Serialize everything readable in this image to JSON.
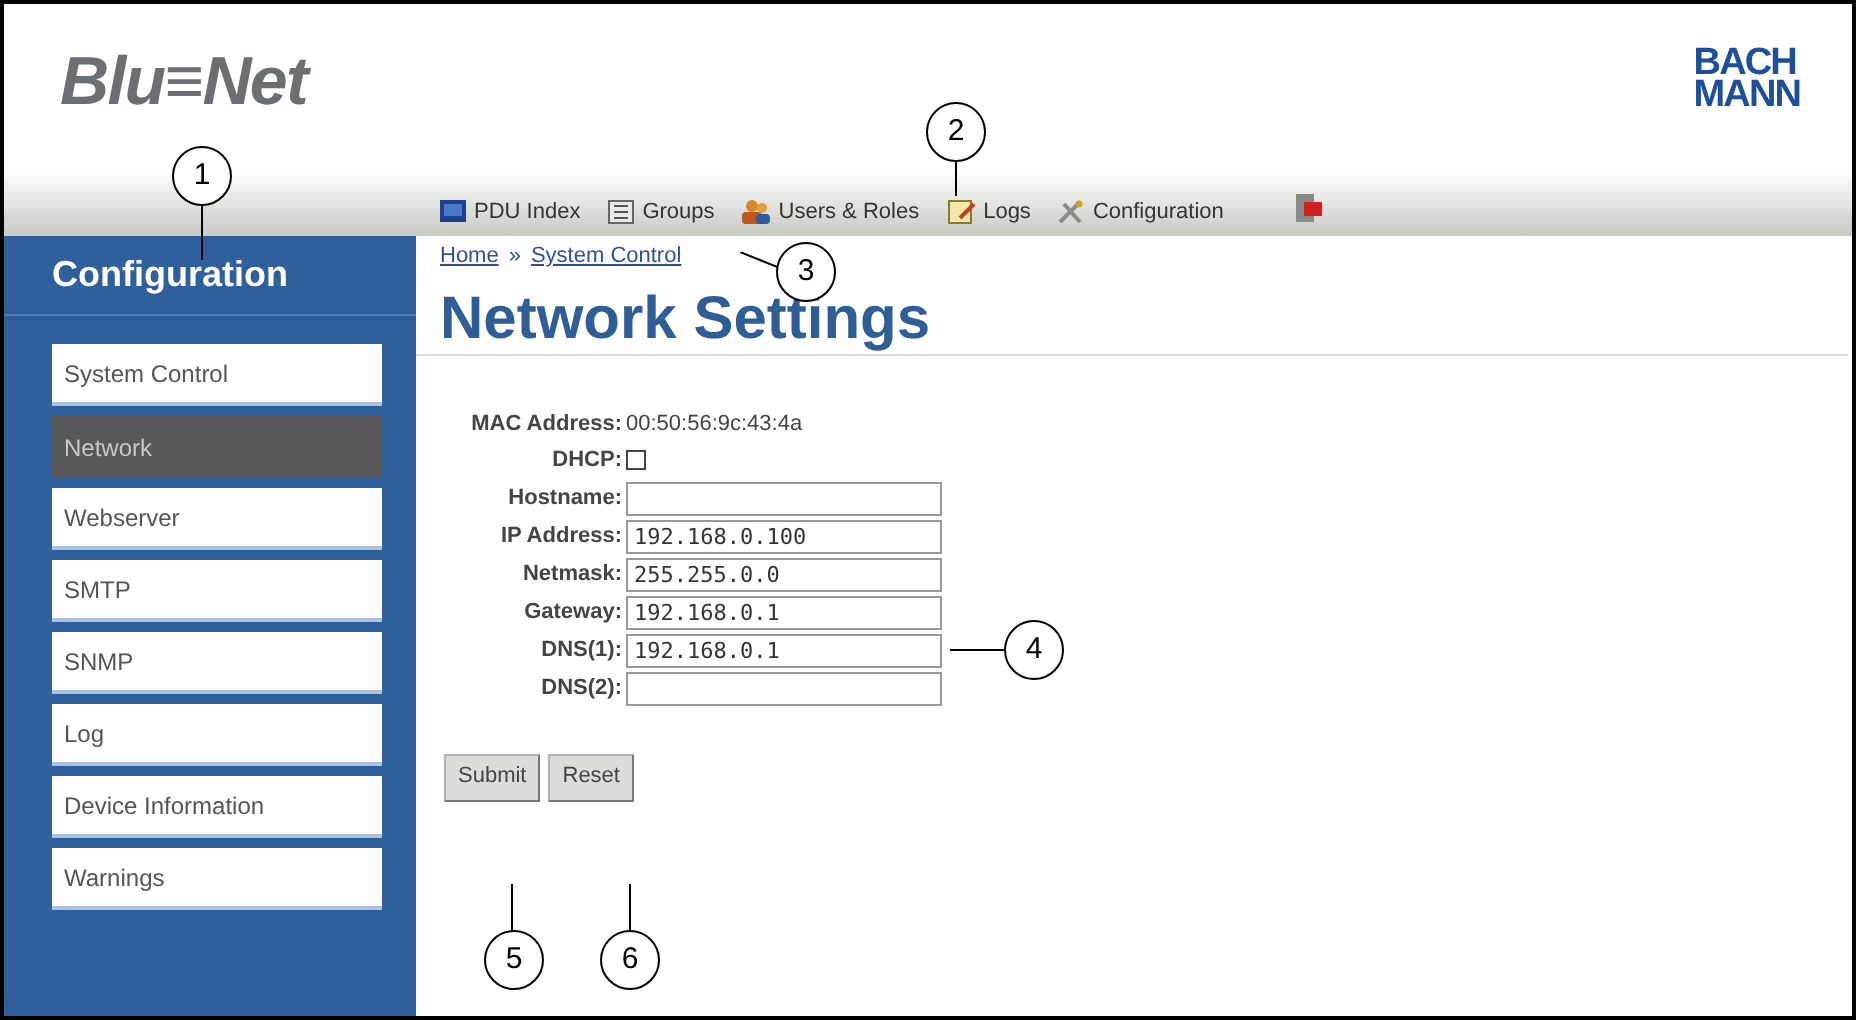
{
  "header": {
    "logo": "Blu≡Net",
    "brand_lines": [
      "BACH",
      "MANN"
    ]
  },
  "nav": [
    {
      "label": "PDU Index",
      "kind": "index"
    },
    {
      "label": "Groups",
      "kind": "groups"
    },
    {
      "label": "Users & Roles",
      "kind": "users"
    },
    {
      "label": "Logs",
      "kind": "logs"
    },
    {
      "label": "Configuration",
      "kind": "tools"
    },
    {
      "kind": "exit"
    }
  ],
  "sidebar": {
    "title": "Configuration",
    "items": [
      {
        "label": "System Control",
        "selected": false
      },
      {
        "label": "Network",
        "selected": true
      },
      {
        "label": "Webserver",
        "selected": false
      },
      {
        "label": "SMTP",
        "selected": false
      },
      {
        "label": "SNMP",
        "selected": false
      },
      {
        "label": "Log",
        "selected": false
      },
      {
        "label": "Device Information",
        "selected": false
      },
      {
        "label": "Warnings",
        "selected": false
      }
    ]
  },
  "breadcrumb": {
    "links": [
      "Home",
      "System Control"
    ],
    "separator": "»"
  },
  "page_title": "Network Settings",
  "form": [
    {
      "kind": "text",
      "label": "MAC Address:",
      "value": "00:50:56:9c:43:4a"
    },
    {
      "kind": "checkbox",
      "label": "DHCP:",
      "checked": false
    },
    {
      "kind": "input",
      "label": "Hostname:"
    },
    {
      "kind": "input",
      "label": "IP Address:",
      "value": "192.168.0.100"
    },
    {
      "kind": "input",
      "label": "Netmask:",
      "value": "255.255.0.0"
    },
    {
      "kind": "input",
      "label": "Gateway:",
      "value": "192.168.0.1"
    },
    {
      "kind": "input",
      "label": "DNS(1):",
      "value": "192.168.0.1"
    },
    {
      "kind": "input",
      "label": "DNS(2):"
    }
  ],
  "buttons": [
    "Submit",
    "Reset"
  ],
  "callouts": [
    "1",
    "2",
    "3",
    "4",
    "5",
    "6"
  ]
}
